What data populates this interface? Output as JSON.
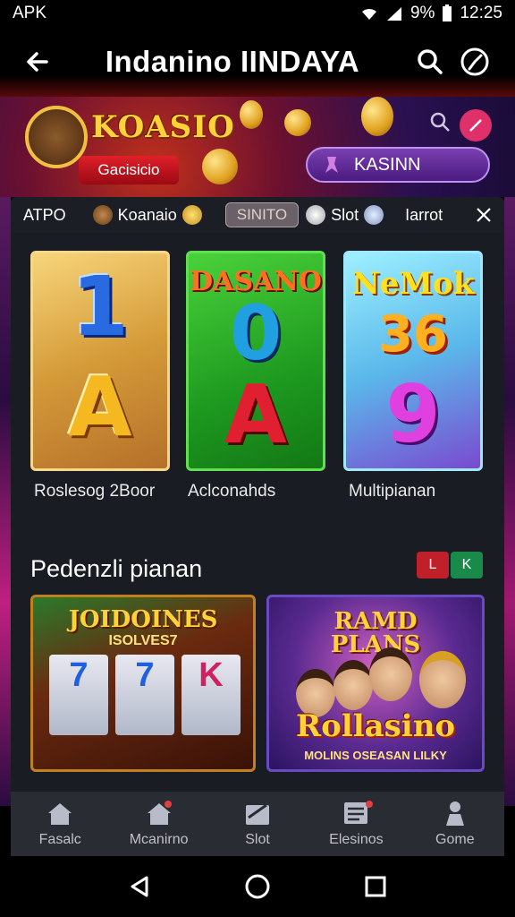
{
  "status_bar": {
    "left_text": "APK",
    "battery": "9%",
    "time": "12:25"
  },
  "app_bar": {
    "title": "Indanino IINDAYA"
  },
  "hero": {
    "brand": "KOASIO",
    "badge": "Gacisicio",
    "user_pill_label": "KASINN"
  },
  "filter_bar": {
    "items": [
      {
        "label": "ATPO"
      },
      {
        "label": "Koanaio"
      },
      {
        "label": "SINITO"
      },
      {
        "label": "Slot"
      },
      {
        "label": "Iarrot"
      }
    ]
  },
  "game_cards": [
    {
      "label": "Roslesog 2Boor",
      "glyph_top": "1",
      "glyph_bottom": "A",
      "heading": ""
    },
    {
      "label": "Aclconahds",
      "glyph_top": "0",
      "glyph_bottom": "A",
      "heading": "DASANO"
    },
    {
      "label": "Multipianan",
      "glyph_top": "36",
      "glyph_bottom": "9",
      "heading": "NeMok"
    }
  ],
  "section": {
    "title": "Pedenzli pianan",
    "ctl_left": "L",
    "ctl_right": "K"
  },
  "promos": {
    "left": {
      "title": "JOIDOINES",
      "subtitle": "ISOLVES7",
      "reels": [
        "7",
        "7",
        "K"
      ]
    },
    "right": {
      "title": "RAMD PLANS",
      "brand": "Rollasino",
      "footer": "MOLINS OSEASAN LILKY"
    }
  },
  "bottom_nav": {
    "items": [
      {
        "label": "Fasalc",
        "icon": "home-icon"
      },
      {
        "label": "Mcanirno",
        "icon": "house-badge-icon"
      },
      {
        "label": "Slot",
        "icon": "slot-icon"
      },
      {
        "label": "Elesinos",
        "icon": "list-icon"
      },
      {
        "label": "Gome",
        "icon": "person-icon"
      }
    ]
  },
  "colors": {
    "accent_gold": "#ffd23a",
    "accent_purple": "#7a40b0",
    "panel_bg": "#1a1c23"
  }
}
